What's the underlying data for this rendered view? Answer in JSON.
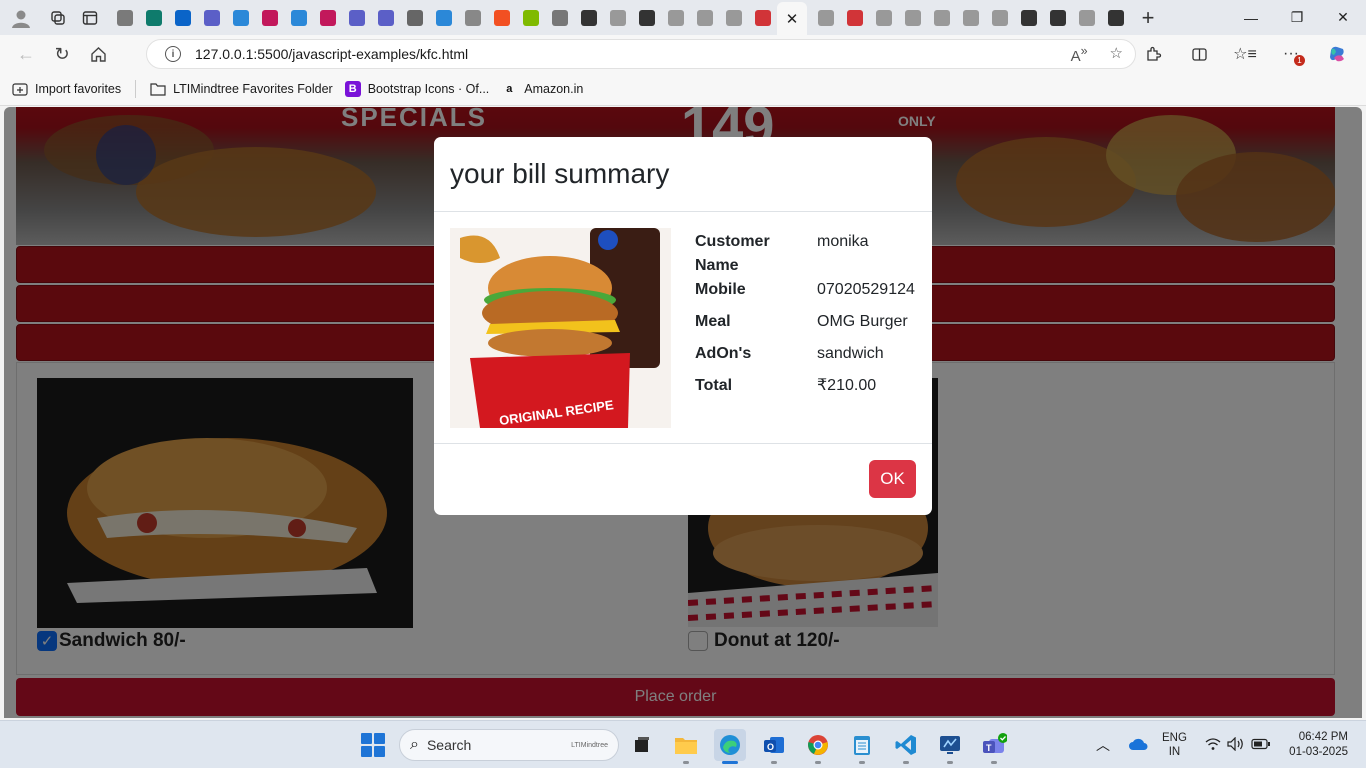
{
  "browser": {
    "tabs": [
      {
        "name": "tab-generic-1",
        "color": "#7a7a7a"
      },
      {
        "name": "tab-sharepoint",
        "color": "#0f7b6c"
      },
      {
        "name": "tab-outlook",
        "color": "#0a64c8"
      },
      {
        "name": "tab-teams",
        "color": "#5b5fc7"
      },
      {
        "name": "tab-onedrive",
        "color": "#2b88d8"
      },
      {
        "name": "tab-stream",
        "color": "#c2185b"
      },
      {
        "name": "tab-onedrive-2",
        "color": "#2b88d8"
      },
      {
        "name": "tab-stream-2",
        "color": "#c2185b"
      },
      {
        "name": "tab-teams-2",
        "color": "#5b5fc7"
      },
      {
        "name": "tab-teams-3",
        "color": "#5b5fc7"
      },
      {
        "name": "tab-settings",
        "color": "#666666"
      },
      {
        "name": "tab-onedrive-3",
        "color": "#2b88d8"
      },
      {
        "name": "tab-generic-2",
        "color": "#888888"
      },
      {
        "name": "tab-microsoft",
        "color": "#f25022"
      },
      {
        "name": "tab-microsoft-2",
        "color": "#7fba00"
      },
      {
        "name": "tab-globe-1",
        "color": "#777777"
      },
      {
        "name": "tab-chatgpt",
        "color": "#333333"
      },
      {
        "name": "tab-chatgpt-2",
        "color": "#999999"
      },
      {
        "name": "tab-globe-2",
        "color": "#333333"
      },
      {
        "name": "tab-globe-3",
        "color": "#999999"
      },
      {
        "name": "tab-globe-4",
        "color": "#999999"
      },
      {
        "name": "tab-globe-5",
        "color": "#999999"
      },
      {
        "name": "tab-pdf",
        "color": "#d13438"
      }
    ],
    "tabs_after": [
      {
        "name": "tab-globe-6",
        "color": "#999999"
      },
      {
        "name": "tab-pdf-2",
        "color": "#d13438"
      },
      {
        "name": "tab-globe-7",
        "color": "#999999"
      },
      {
        "name": "tab-globe-8",
        "color": "#999999"
      },
      {
        "name": "tab-globe-9",
        "color": "#999999"
      },
      {
        "name": "tab-globe-10",
        "color": "#999999"
      },
      {
        "name": "tab-globe-11",
        "color": "#999999"
      },
      {
        "name": "tab-globe-12",
        "color": "#333333"
      },
      {
        "name": "tab-globe-13",
        "color": "#333333"
      },
      {
        "name": "tab-globe-14",
        "color": "#999999"
      },
      {
        "name": "tab-globe-15",
        "color": "#333333"
      }
    ],
    "url": "127.0.0.1:5500/javascript-examples/kfc.html",
    "notification_count": "1",
    "favorites": [
      {
        "label": "Import favorites",
        "icon": "import-icon"
      },
      {
        "label": "LTIMindtree Favorites Folder",
        "icon": "folder-icon"
      },
      {
        "label": "Bootstrap Icons · Of...",
        "icon": "bootstrap-icon"
      },
      {
        "label": "Amazon.in",
        "icon": "amazon-icon"
      }
    ]
  },
  "page": {
    "banner_title": "SPECIALS",
    "banner_price": "149",
    "banner_only": "ONLY",
    "addons": [
      {
        "label": "Sandwich 80/-",
        "checked": true
      },
      {
        "label": "Donut at 120/-",
        "checked": false
      }
    ],
    "place_order_label": "Place order"
  },
  "modal": {
    "title": "your bill summary",
    "rows": [
      {
        "key": "Customer Name",
        "value": "monika"
      },
      {
        "key": "Mobile",
        "value": "07020529124"
      },
      {
        "key": "Meal",
        "value": "OMG Burger"
      },
      {
        "key": "AdOn's",
        "value": "sandwich"
      },
      {
        "key": "Total",
        "value": "₹210.00"
      }
    ],
    "ok_label": "OK",
    "meal_image_text": "ORIGINAL RECIPE"
  },
  "taskbar": {
    "search_label": "Search",
    "search_brand": "LTIMindtree",
    "language_line1": "ENG",
    "language_line2": "IN",
    "time": "06:42 PM",
    "date": "01-03-2025"
  }
}
